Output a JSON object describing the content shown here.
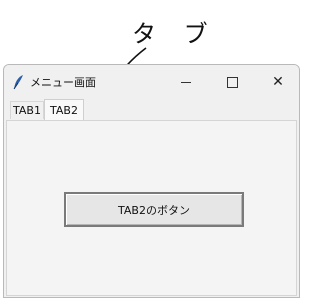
{
  "annotation": {
    "label": "タ ブ"
  },
  "window": {
    "title": "メニュー画面",
    "app_icon": "feather-icon",
    "controls": {
      "minimize_icon": "minimize-icon",
      "maximize_icon": "maximize-icon",
      "close_icon": "close-icon",
      "close_label": "✕"
    }
  },
  "tabs": [
    {
      "label": "TAB1",
      "selected": false
    },
    {
      "label": "TAB2",
      "selected": true
    }
  ],
  "panel": {
    "button_label": "TAB2のボタン"
  }
}
